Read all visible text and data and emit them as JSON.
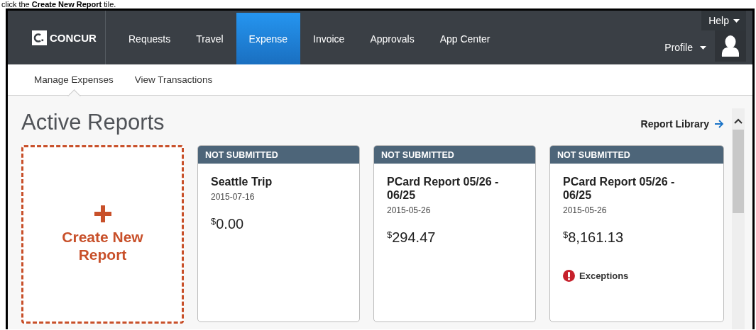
{
  "caption": "click the **Create New Report** tile.",
  "nav": {
    "logo": "CONCUR",
    "tabs": [
      {
        "label": "Requests",
        "selected": false
      },
      {
        "label": "Travel",
        "selected": false
      },
      {
        "label": "Expense",
        "selected": true
      },
      {
        "label": "Invoice",
        "selected": false
      },
      {
        "label": "Approvals",
        "selected": false
      },
      {
        "label": "App Center",
        "selected": false
      }
    ],
    "help": "Help",
    "profile": "Profile"
  },
  "subnav": [
    {
      "label": "Manage Expenses",
      "selected": true
    },
    {
      "label": "View Transactions",
      "selected": false
    }
  ],
  "page": {
    "title": "Active Reports",
    "library_link": "Report Library",
    "create_tile": "Create New Report"
  },
  "reports": [
    {
      "status": "NOT SUBMITTED",
      "name": "Seattle Trip",
      "date": "2015-07-16",
      "currency": "$",
      "amount": "0.00"
    },
    {
      "status": "NOT SUBMITTED",
      "name": "PCard Report 05/26 - 06/25",
      "date": "2015-05-26",
      "currency": "$",
      "amount": "294.47"
    },
    {
      "status": "NOT SUBMITTED",
      "name": "PCard Report 05/26 - 06/25",
      "date": "2015-05-26",
      "currency": "$",
      "amount": "8,161.13",
      "exceptions": "Exceptions"
    }
  ]
}
